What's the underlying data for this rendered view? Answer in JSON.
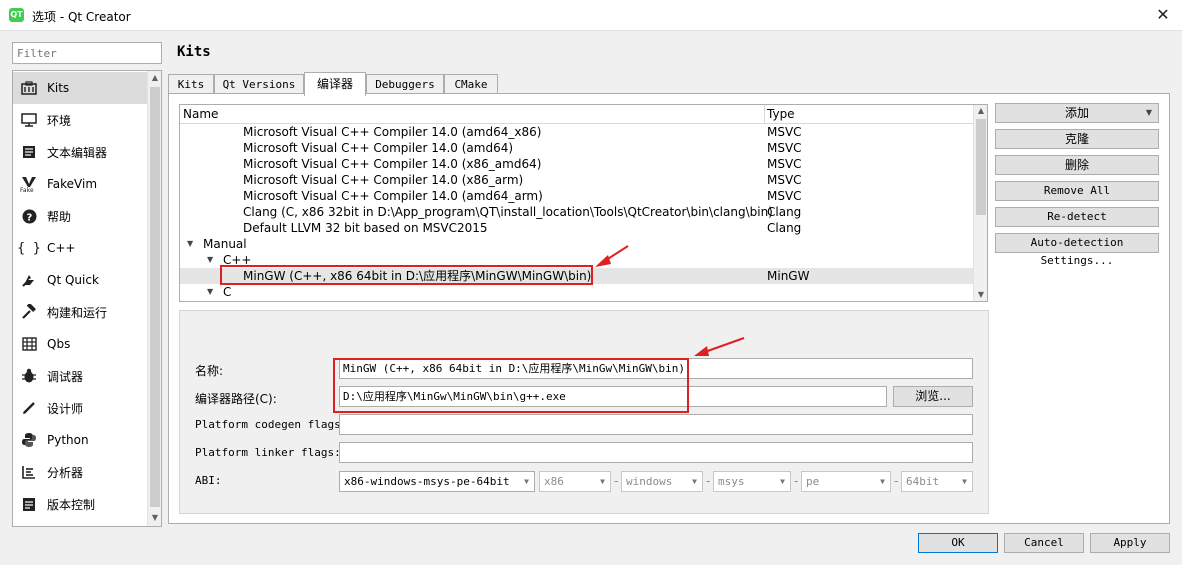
{
  "window": {
    "title": "选项 - Qt Creator",
    "app_icon": "QT",
    "close_symbol": "✕"
  },
  "filter": {
    "placeholder": "Filter"
  },
  "sidebar": {
    "items": [
      {
        "label": "Kits",
        "icon": "kits-icon"
      },
      {
        "label": "环境",
        "icon": "monitor-icon"
      },
      {
        "label": "文本编辑器",
        "icon": "text-editor-icon"
      },
      {
        "label": "FakeVim",
        "icon": "fakevim-icon"
      },
      {
        "label": "帮助",
        "icon": "help-icon"
      },
      {
        "label": "C++",
        "icon": "braces-icon"
      },
      {
        "label": "Qt Quick",
        "icon": "qt-quick-icon"
      },
      {
        "label": "构建和运行",
        "icon": "hammer-icon"
      },
      {
        "label": "Qbs",
        "icon": "qbs-icon"
      },
      {
        "label": "调试器",
        "icon": "bug-icon"
      },
      {
        "label": "设计师",
        "icon": "pen-icon"
      },
      {
        "label": "Python",
        "icon": "python-icon"
      },
      {
        "label": "分析器",
        "icon": "analyzer-icon"
      },
      {
        "label": "版本控制",
        "icon": "version-control-icon"
      }
    ],
    "selected": "Kits"
  },
  "page_title": "Kits",
  "tabs": [
    {
      "label": "Kits"
    },
    {
      "label": "Qt Versions"
    },
    {
      "label": "编译器",
      "active": true
    },
    {
      "label": "Debuggers"
    },
    {
      "label": "CMake"
    }
  ],
  "tree": {
    "columns": [
      "Name",
      "Type"
    ],
    "rows": [
      {
        "name": "Microsoft Visual C++ Compiler 14.0 (amd64_x86)",
        "type": "MSVC"
      },
      {
        "name": "Microsoft Visual C++ Compiler 14.0 (amd64)",
        "type": "MSVC"
      },
      {
        "name": "Microsoft Visual C++ Compiler 14.0 (x86_amd64)",
        "type": "MSVC"
      },
      {
        "name": "Microsoft Visual C++ Compiler 14.0 (x86_arm)",
        "type": "MSVC"
      },
      {
        "name": "Microsoft Visual C++ Compiler 14.0 (amd64_arm)",
        "type": "MSVC"
      },
      {
        "name": "Clang (C, x86 32bit in D:\\App_program\\QT\\install_location\\Tools\\QtCreator\\bin\\clang\\bin)",
        "type": "Clang"
      },
      {
        "name": "Default LLVM 32 bit based on MSVC2015",
        "type": "Clang"
      }
    ],
    "manual_group": "Manual",
    "cpp_group": "C++",
    "selected_row": {
      "name": "MinGW (C++, x86 64bit in D:\\应用程序\\MinGW\\MinGW\\bin)",
      "type": "MinGW"
    },
    "c_group": "C"
  },
  "buttons": {
    "add": "添加",
    "clone": "克隆",
    "delete": "删除",
    "remove_all": "Remove All",
    "redetect": "Re-detect",
    "auto_detection": "Auto-detection Settings..."
  },
  "details": {
    "name_label": "名称:",
    "name_value": "MinGW (C++, x86 64bit in D:\\应用程序\\MinGw\\MinGW\\bin)",
    "path_label": "编译器路径(C):",
    "path_value": "D:\\应用程序\\MinGw\\MinGW\\bin\\g++.exe",
    "browse": "浏览...",
    "codegen_label": "Platform codegen flags:",
    "linker_label": "Platform linker flags:",
    "abi_label": "ABI:",
    "abi_value": "x86-windows-msys-pe-64bit",
    "abi_parts": [
      "x86",
      "windows",
      "msys",
      "pe",
      "64bit"
    ],
    "separator": "-"
  },
  "bottom_buttons": {
    "ok": "OK",
    "cancel": "Cancel",
    "apply": "Apply"
  },
  "colors": {
    "annotation_red": "#e02020",
    "selection_gray": "#dcdcdc",
    "qt_green": "#41cd52"
  }
}
